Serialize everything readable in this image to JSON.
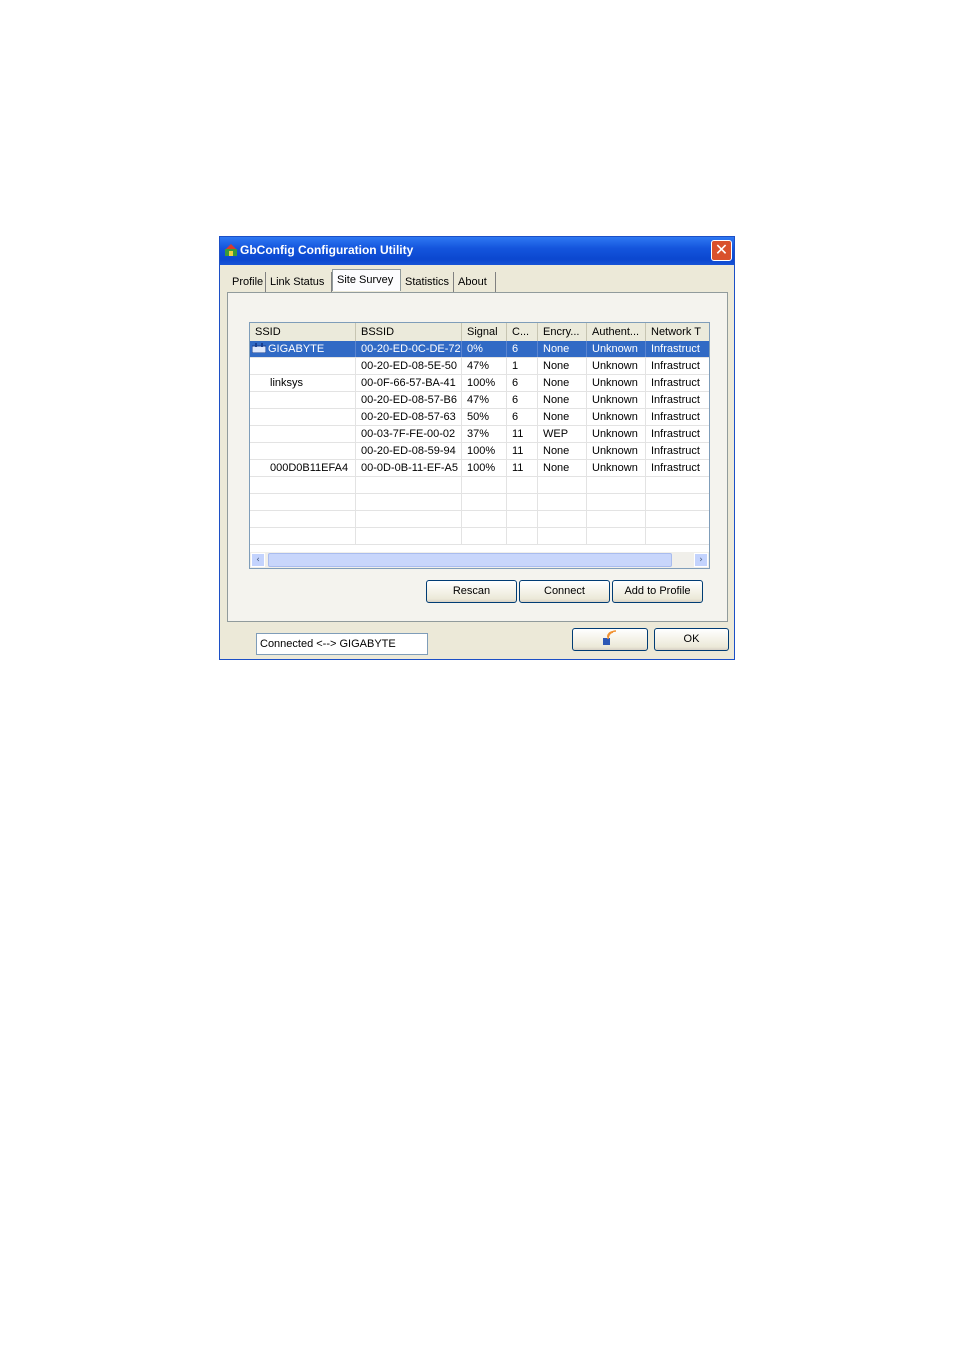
{
  "window": {
    "title": "GbConfig Configuration Utility",
    "close_label": "✕"
  },
  "tabs": [
    {
      "label": "Profile"
    },
    {
      "label": "Link Status"
    },
    {
      "label": "Site Survey",
      "active": true
    },
    {
      "label": "Statistics"
    },
    {
      "label": "About"
    }
  ],
  "table": {
    "columns": [
      "SSID",
      "BSSID",
      "Signal",
      "C...",
      "Encry...",
      "Authent...",
      "Network T"
    ],
    "rows": [
      {
        "ssid": "GIGABYTE",
        "bssid": "00-20-ED-0C-DE-72",
        "signal": "0%",
        "channel": "6",
        "encryption": "None",
        "auth": "Unknown",
        "network": "Infrastruct",
        "selected": true,
        "connected": true
      },
      {
        "ssid": "",
        "bssid": "00-20-ED-08-5E-50",
        "signal": "47%",
        "channel": "1",
        "encryption": "None",
        "auth": "Unknown",
        "network": "Infrastruct"
      },
      {
        "ssid": "linksys",
        "bssid": "00-0F-66-57-BA-41",
        "signal": "100%",
        "channel": "6",
        "encryption": "None",
        "auth": "Unknown",
        "network": "Infrastruct"
      },
      {
        "ssid": "",
        "bssid": "00-20-ED-08-57-B6",
        "signal": "47%",
        "channel": "6",
        "encryption": "None",
        "auth": "Unknown",
        "network": "Infrastruct"
      },
      {
        "ssid": "",
        "bssid": "00-20-ED-08-57-63",
        "signal": "50%",
        "channel": "6",
        "encryption": "None",
        "auth": "Unknown",
        "network": "Infrastruct"
      },
      {
        "ssid": "",
        "bssid": "00-03-7F-FE-00-02",
        "signal": "37%",
        "channel": "11",
        "encryption": "WEP",
        "auth": "Unknown",
        "network": "Infrastruct"
      },
      {
        "ssid": "",
        "bssid": "00-20-ED-08-59-94",
        "signal": "100%",
        "channel": "11",
        "encryption": "None",
        "auth": "Unknown",
        "network": "Infrastruct"
      },
      {
        "ssid": "000D0B11EFA4",
        "bssid": "00-0D-0B-11-EF-A5",
        "signal": "100%",
        "channel": "11",
        "encryption": "None",
        "auth": "Unknown",
        "network": "Infrastruct"
      },
      {},
      {},
      {},
      {}
    ]
  },
  "scrollbar": {
    "left_icon": "chevron-left-icon",
    "right_icon": "chevron-right-icon",
    "left_glyph": "‹",
    "right_glyph": "›"
  },
  "status": {
    "text": "Connected <--> GIGABYTE"
  },
  "buttons": {
    "rescan": "Rescan",
    "connect": "Connect",
    "add_to_profile": "Add to Profile",
    "ok": "OK",
    "tray_icon": "wireless-tray-icon"
  },
  "colors": {
    "titlebar": "#0b47cf",
    "selection": "#316ac5",
    "close": "#d9512c"
  }
}
